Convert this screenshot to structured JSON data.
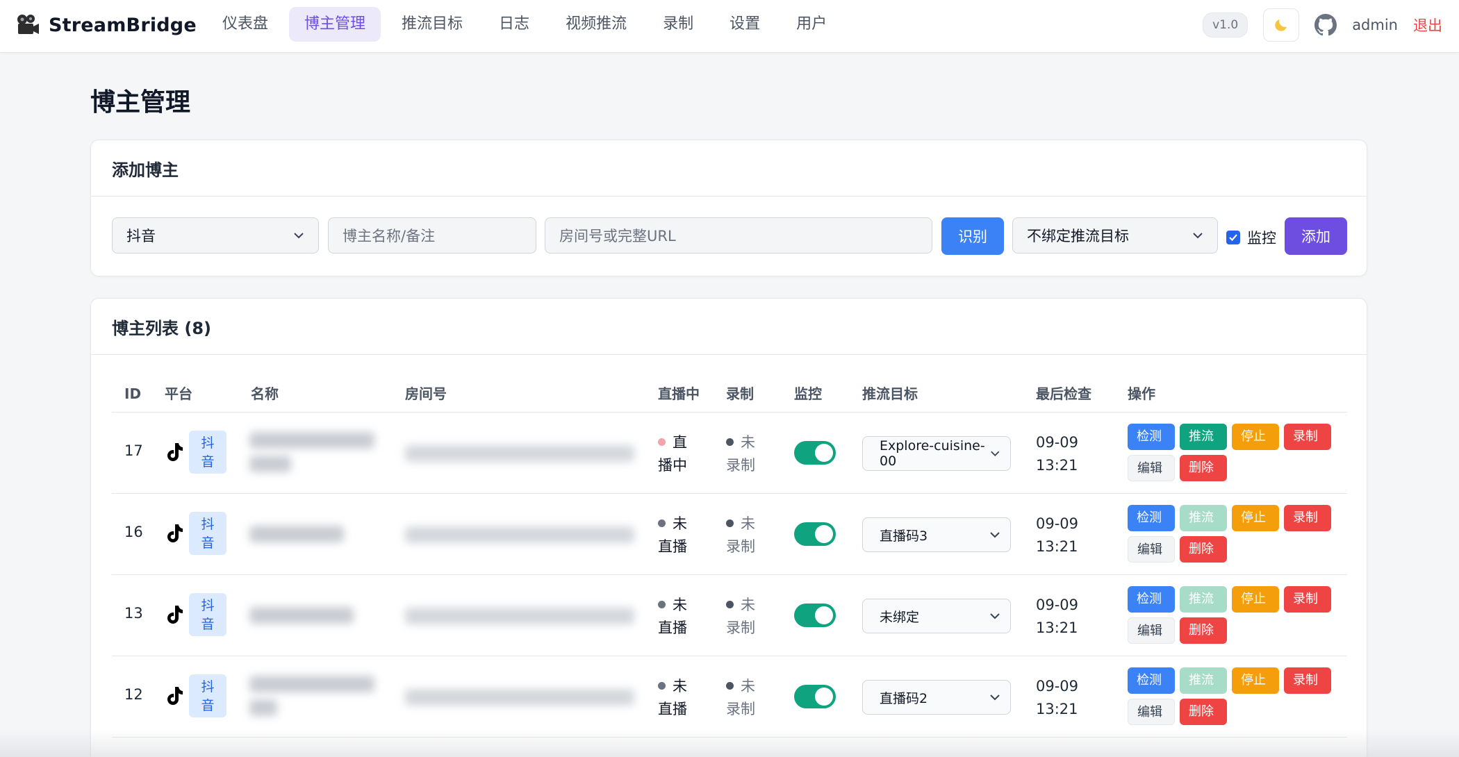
{
  "app": {
    "name": "StreamBridge",
    "version": "v1.0",
    "user": "admin",
    "logout": "退出"
  },
  "nav": [
    "仪表盘",
    "博主管理",
    "推流目标",
    "日志",
    "视频推流",
    "录制",
    "设置",
    "用户"
  ],
  "nav_active": "博主管理",
  "page_title": "博主管理",
  "add_form": {
    "title": "添加博主",
    "platform_value": "抖音",
    "name_placeholder": "博主名称/备注",
    "room_placeholder": "房间号或完整URL",
    "recognize_label": "识别",
    "target_value": "不绑定推流目标",
    "monitor_label": "监控",
    "monitor_checked": true,
    "add_label": "添加"
  },
  "list": {
    "title": "博主列表 (8)",
    "columns": [
      "ID",
      "平台",
      "名称",
      "房间号",
      "直播中",
      "录制",
      "监控",
      "推流目标",
      "最后检查",
      "操作"
    ],
    "actions": {
      "detect": "检测",
      "push": "推流",
      "stop": "停止",
      "record": "录制",
      "edit": "编辑",
      "delete": "删除"
    },
    "rows": [
      {
        "id": "17",
        "platform": "抖音",
        "live_l1": "直",
        "live_l2": "播中",
        "live_color": "#f4a3a8",
        "rec_l1": "未",
        "rec_l2": "录制",
        "monitor": true,
        "target": "Explore-cuisine-00",
        "check_date": "09-09",
        "check_time": "13:21",
        "push_enabled": true
      },
      {
        "id": "16",
        "platform": "抖音",
        "live_l1": "未",
        "live_l2": "直播",
        "live_color": "#6b7280",
        "rec_l1": "未",
        "rec_l2": "录制",
        "monitor": true,
        "target": "直播码3",
        "check_date": "09-09",
        "check_time": "13:21",
        "push_enabled": false
      },
      {
        "id": "13",
        "platform": "抖音",
        "live_l1": "未",
        "live_l2": "直播",
        "live_color": "#6b7280",
        "rec_l1": "未",
        "rec_l2": "录制",
        "monitor": true,
        "target": "未绑定",
        "check_date": "09-09",
        "check_time": "13:21",
        "push_enabled": false
      },
      {
        "id": "12",
        "platform": "抖音",
        "live_l1": "未",
        "live_l2": "直播",
        "live_color": "#6b7280",
        "rec_l1": "未",
        "rec_l2": "录制",
        "monitor": true,
        "target": "直播码2",
        "check_date": "09-09",
        "check_time": "13:21",
        "push_enabled": false
      }
    ]
  },
  "colors": {
    "accent": "#6d4ee0",
    "primary": "#3b82f6",
    "success": "#10a37f",
    "warning": "#f59e0b",
    "danger": "#ef4444"
  },
  "icons": [
    "camera-logo-icon",
    "moon-icon",
    "github-icon",
    "tiktok-icon",
    "chevron-down-icon",
    "check-icon"
  ]
}
